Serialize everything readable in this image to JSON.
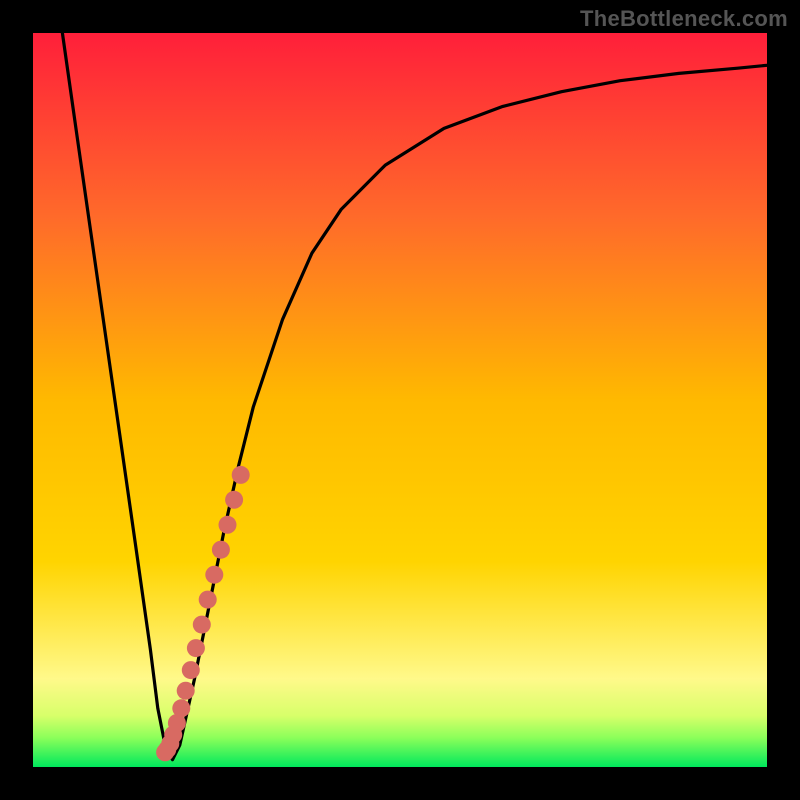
{
  "watermark": "TheBottleneck.com",
  "chart_data": {
    "type": "line",
    "title": "",
    "xlabel": "",
    "ylabel": "",
    "xlim": [
      0,
      100
    ],
    "ylim": [
      0,
      100
    ],
    "grid": false,
    "legend": false,
    "colors": {
      "gradient_top": "#ff1f3a",
      "gradient_mid": "#ffd400",
      "gradient_bottom": "#00e85c",
      "curve": "#000000",
      "marker": "#d86a62",
      "frame": "#000000"
    },
    "series": [
      {
        "name": "bottleneck-curve",
        "x": [
          4,
          6,
          8,
          10,
          12,
          14,
          16,
          17,
          18,
          19,
          20,
          22,
          24,
          26,
          28,
          30,
          34,
          38,
          42,
          48,
          56,
          64,
          72,
          80,
          88,
          96,
          100
        ],
        "y": [
          100,
          86,
          72,
          58,
          44,
          30,
          16,
          8,
          3,
          1,
          3,
          12,
          22,
          32,
          41,
          49,
          61,
          70,
          76,
          82,
          87,
          90,
          92,
          93.5,
          94.5,
          95.2,
          95.6
        ]
      }
    ],
    "markers": {
      "name": "dotted-segment",
      "x": [
        18.0,
        18.3,
        18.7,
        19.1,
        19.6,
        20.2,
        20.8,
        21.5,
        22.2,
        23.0,
        23.8,
        24.7,
        25.6,
        26.5,
        27.4,
        28.3
      ],
      "y": [
        2.0,
        2.4,
        3.2,
        4.4,
        6.0,
        8.0,
        10.4,
        13.2,
        16.2,
        19.4,
        22.8,
        26.2,
        29.6,
        33.0,
        36.4,
        39.8
      ]
    }
  }
}
